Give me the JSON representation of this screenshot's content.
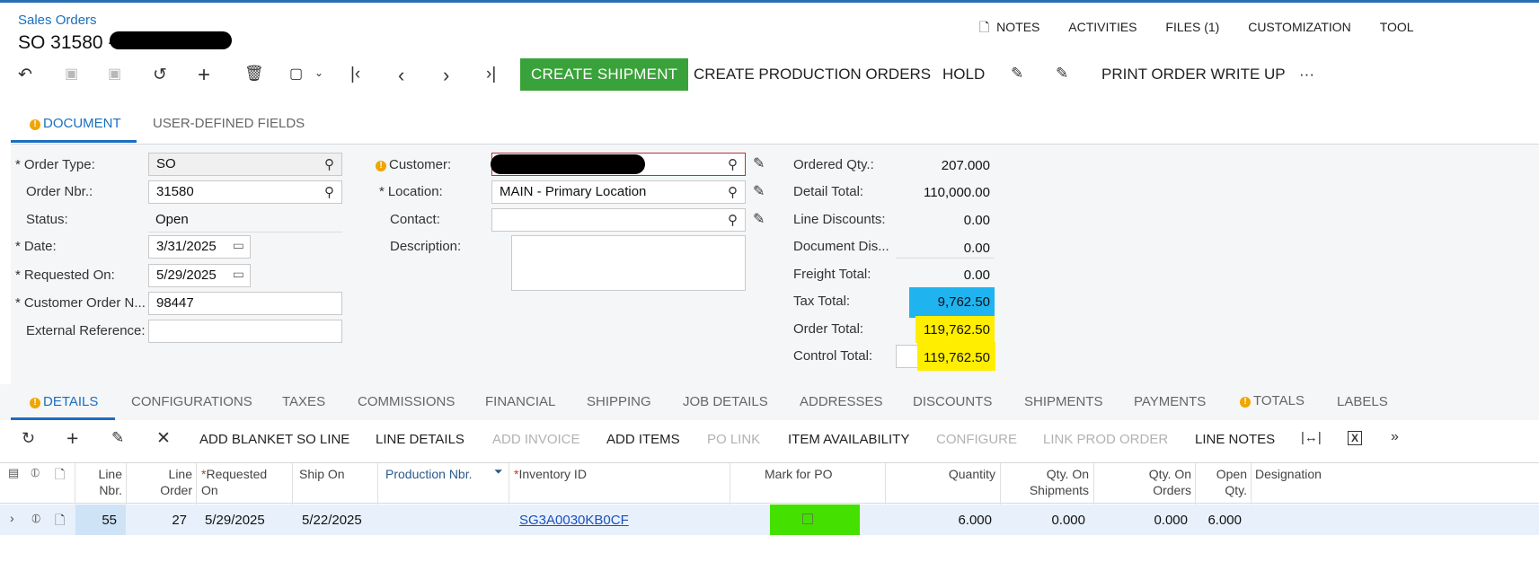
{
  "header": {
    "breadcrumb": "Sales Orders",
    "title": "SO 31580 -",
    "links": [
      "NOTES",
      "ACTIVITIES",
      "FILES (1)",
      "CUSTOMIZATION",
      "TOOL"
    ]
  },
  "toolbar": {
    "create_shipment": "CREATE SHIPMENT",
    "create_production_orders": "CREATE PRODUCTION ORDERS",
    "hold": "HOLD",
    "print_order_write_up": "PRINT ORDER WRITE UP",
    "more": "···"
  },
  "form_tabs": {
    "document": "DOCUMENT",
    "user_defined_fields": "USER-DEFINED FIELDS"
  },
  "form": {
    "order_type_label": "Order Type:",
    "order_type_value": "SO",
    "order_nbr_label": "Order Nbr.:",
    "order_nbr_value": "31580",
    "status_label": "Status:",
    "status_value": "Open",
    "date_label": "Date:",
    "date_value": "3/31/2025",
    "requested_on_label": "Requested On:",
    "requested_on_value": "5/29/2025",
    "customer_order_label": "Customer Order N...",
    "customer_order_value": "98447",
    "external_ref_label": "External Reference:",
    "external_ref_value": "",
    "customer_label": "Customer:",
    "customer_value": "",
    "location_label": "Location:",
    "location_value": "MAIN - Primary Location",
    "contact_label": "Contact:",
    "contact_value": "",
    "description_label": "Description:",
    "description_value": ""
  },
  "totals": {
    "ordered_qty_label": "Ordered Qty.:",
    "ordered_qty_value": "207.000",
    "detail_total_label": "Detail Total:",
    "detail_total_value": "110,000.00",
    "line_discounts_label": "Line Discounts:",
    "line_discounts_value": "0.00",
    "document_dis_label": "Document Dis...",
    "document_dis_value": "0.00",
    "freight_total_label": "Freight Total:",
    "freight_total_value": "0.00",
    "tax_total_label": "Tax Total:",
    "tax_total_value": "9,762.50",
    "order_total_label": "Order Total:",
    "order_total_value": "119,762.50",
    "control_total_label": "Control Total:",
    "control_total_value": "119,762.50"
  },
  "colors": {
    "tax_highlight": "#1fb4f0",
    "yellow_highlight": "#ffee00",
    "green_button": "#3aa23a",
    "mark_for_po": "#44e000"
  },
  "detail_tabs": [
    "DETAILS",
    "CONFIGURATIONS",
    "TAXES",
    "COMMISSIONS",
    "FINANCIAL",
    "SHIPPING",
    "JOB DETAILS",
    "ADDRESSES",
    "DISCOUNTS",
    "SHIPMENTS",
    "PAYMENTS",
    "TOTALS",
    "LABELS"
  ],
  "grid_toolbar": {
    "add_blanket_so_line": "ADD BLANKET SO LINE",
    "line_details": "LINE DETAILS",
    "add_invoice": "ADD INVOICE",
    "add_items": "ADD ITEMS",
    "po_link": "PO LINK",
    "item_availability": "ITEM AVAILABILITY",
    "configure": "CONFIGURE",
    "link_prod_order": "LINK PROD ORDER",
    "line_notes": "LINE NOTES"
  },
  "grid": {
    "headers": {
      "line_nbr": "Line Nbr.",
      "line_order": "Line Order",
      "requested_on": "Requested On",
      "ship_on": "Ship On",
      "production_nbr": "Production Nbr.",
      "inventory_id": "Inventory ID",
      "mark_for_po": "Mark for PO",
      "quantity": "Quantity",
      "qty_on_shipments": "Qty. On Shipments",
      "qty_on_orders": "Qty. On Orders",
      "open_qty": "Open Qty.",
      "designation": "Designation"
    },
    "rows": [
      {
        "line_nbr": "55",
        "line_order": "27",
        "requested_on": "5/29/2025",
        "ship_on": "5/22/2025",
        "production_nbr": "",
        "inventory_id": "SG3A0030KB0CF",
        "quantity": "6.000",
        "qty_on_shipments": "0.000",
        "qty_on_orders": "0.000",
        "open_qty": "6.000",
        "designation": ""
      }
    ]
  }
}
